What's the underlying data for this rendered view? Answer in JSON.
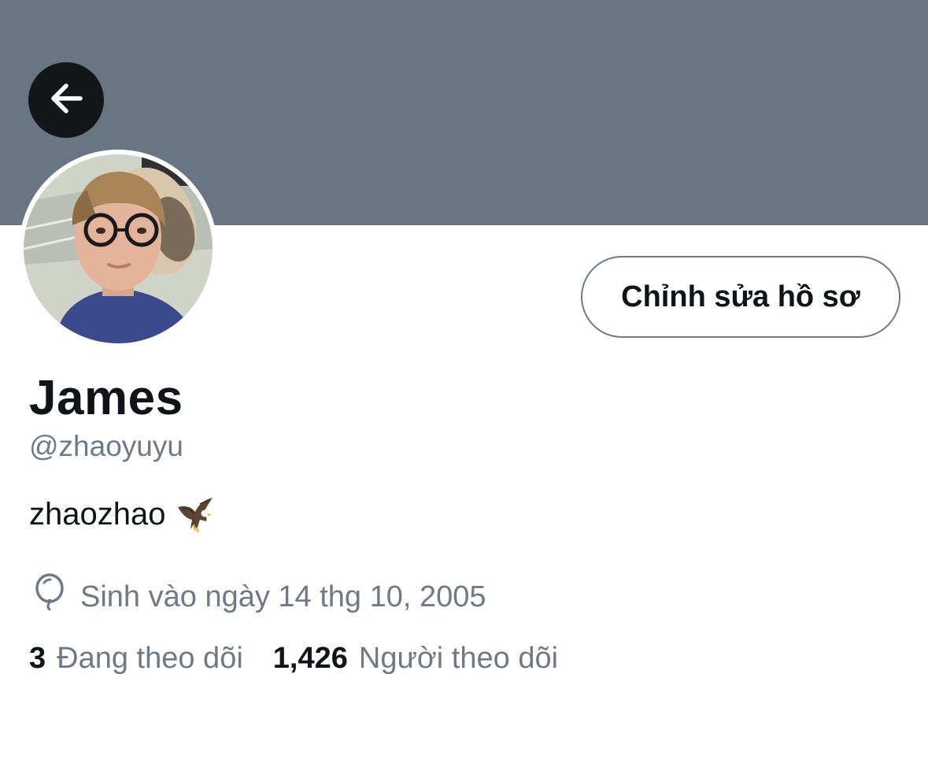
{
  "profile": {
    "edit_button_label": "Chỉnh sửa hồ sơ",
    "display_name": "James",
    "handle": "@zhaoyuyu",
    "bio_text": "zhaozhao",
    "bio_emoji": "eagle-emoji",
    "birthday": "Sinh vào ngày 14 thg 10, 2005"
  },
  "stats": {
    "following_count": "3",
    "following_label": "Đang theo dõi",
    "followers_count": "1,426",
    "followers_label": "Người theo dõi"
  },
  "icons": {
    "back": "arrow-left-icon",
    "birthday": "balloon-icon"
  },
  "colors": {
    "banner": "#687684",
    "text_primary": "#0f1419",
    "text_secondary": "#6e7a85",
    "back_button_bg": "#14171a"
  }
}
